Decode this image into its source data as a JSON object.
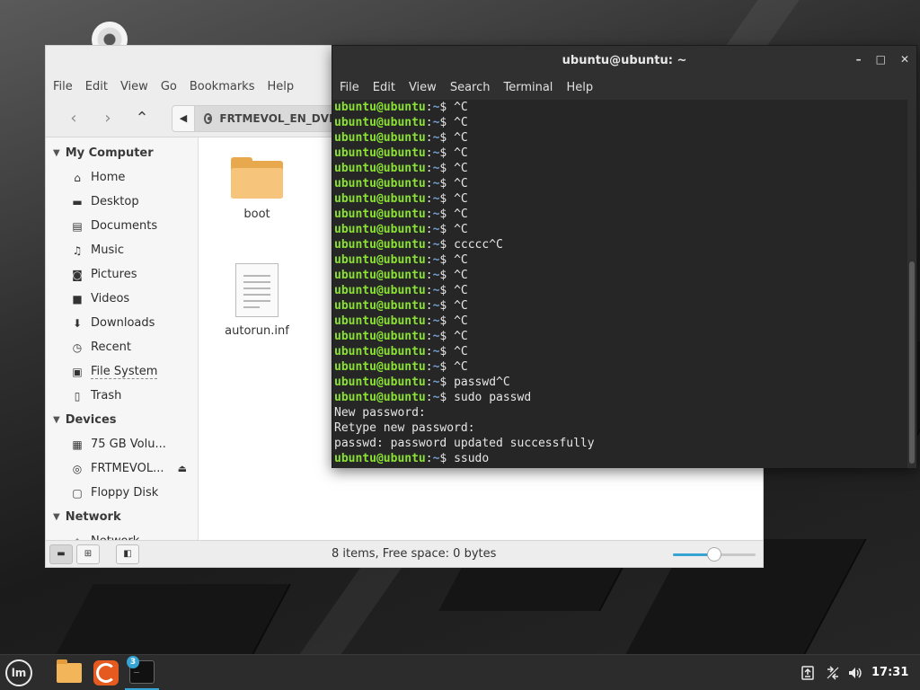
{
  "file_manager": {
    "menu": [
      "File",
      "Edit",
      "View",
      "Go",
      "Bookmarks",
      "Help"
    ],
    "nav": {
      "back": "‹",
      "forward": "›",
      "up": "⌃"
    },
    "path_toggle": "◀",
    "path": "FRTMEVOL_EN_DVD",
    "sidebar": {
      "my_computer": {
        "heading": "My Computer",
        "items": [
          "Home",
          "Desktop",
          "Documents",
          "Music",
          "Pictures",
          "Videos",
          "Downloads",
          "Recent",
          "File System",
          "Trash"
        ]
      },
      "devices": {
        "heading": "Devices",
        "items": [
          "75 GB Volu...",
          "FRTMEVOL...",
          "Floppy Disk"
        ]
      },
      "network": {
        "heading": "Network",
        "items": [
          "Network"
        ]
      }
    },
    "files": [
      {
        "name": "boot",
        "type": "folder"
      },
      {
        "name": "autorun.inf",
        "type": "document"
      }
    ],
    "status": "8 items, Free space: 0 bytes",
    "zoom_level_fraction": 0.5
  },
  "terminal": {
    "title": "ubuntu@ubuntu: ~",
    "menu": [
      "File",
      "Edit",
      "View",
      "Search",
      "Terminal",
      "Help"
    ],
    "prompt_user": "ubuntu@ubuntu",
    "prompt_sep": ":",
    "prompt_path": "~",
    "prompt_end": "$ ",
    "lines": [
      {
        "prompt": true,
        "text": "^C"
      },
      {
        "prompt": true,
        "text": "^C"
      },
      {
        "prompt": true,
        "text": "^C"
      },
      {
        "prompt": true,
        "text": "^C"
      },
      {
        "prompt": true,
        "text": "^C"
      },
      {
        "prompt": true,
        "text": "^C"
      },
      {
        "prompt": true,
        "text": "^C"
      },
      {
        "prompt": true,
        "text": "^C"
      },
      {
        "prompt": true,
        "text": "^C"
      },
      {
        "prompt": true,
        "text": "ccccc^C"
      },
      {
        "prompt": true,
        "text": "^C"
      },
      {
        "prompt": true,
        "text": "^C"
      },
      {
        "prompt": true,
        "text": "^C"
      },
      {
        "prompt": true,
        "text": "^C"
      },
      {
        "prompt": true,
        "text": "^C"
      },
      {
        "prompt": true,
        "text": "^C"
      },
      {
        "prompt": true,
        "text": "^C"
      },
      {
        "prompt": true,
        "text": "^C"
      },
      {
        "prompt": true,
        "text": "passwd^C"
      },
      {
        "prompt": true,
        "text": "sudo passwd"
      },
      {
        "prompt": false,
        "text": "New password:"
      },
      {
        "prompt": false,
        "text": "Retype new password:"
      },
      {
        "prompt": false,
        "text": "passwd: password updated successfully"
      },
      {
        "prompt": true,
        "text": "ssudo"
      }
    ]
  },
  "panel": {
    "menu_label": "lm",
    "terminal_badge": "3",
    "terminal_glyph": "_",
    "clock": "17:31"
  },
  "icons": {
    "minimize": "–",
    "maximize": "□",
    "close": "✕",
    "eject": "⏏"
  }
}
